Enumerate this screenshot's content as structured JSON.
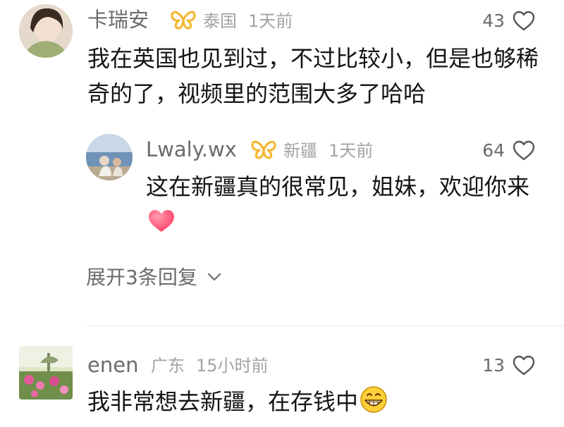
{
  "comments": [
    {
      "username": "卡瑞安",
      "location": "泰国",
      "time": "1天前",
      "likes": "43",
      "text": "我在英国也见到过，不过比较小，但是也够稀奇的了，视频里的范围大多了哈哈",
      "reply": {
        "username": "Lwaly.wx",
        "location": "新疆",
        "time": "1天前",
        "likes": "64",
        "text": "这在新疆真的很常见，姐妹，欢迎你来"
      },
      "expand_label": "展开3条回复"
    },
    {
      "username": "enen",
      "location": "广东",
      "time": "15小时前",
      "likes": "13",
      "text": "我非常想去新疆，在存钱中"
    }
  ],
  "icons": {
    "badge": "butterfly-badge-icon",
    "like": "heart-outline-icon",
    "heart_emoji": "red-heart-emoji",
    "grin_emoji": "grinning-face-emoji",
    "expand": "chevron-down-icon"
  },
  "colors": {
    "badge": "#f5b731",
    "heart_emoji": "#ff4d6d",
    "username": "#6b6b6b",
    "meta": "#a3a3a3",
    "text": "#141414"
  }
}
